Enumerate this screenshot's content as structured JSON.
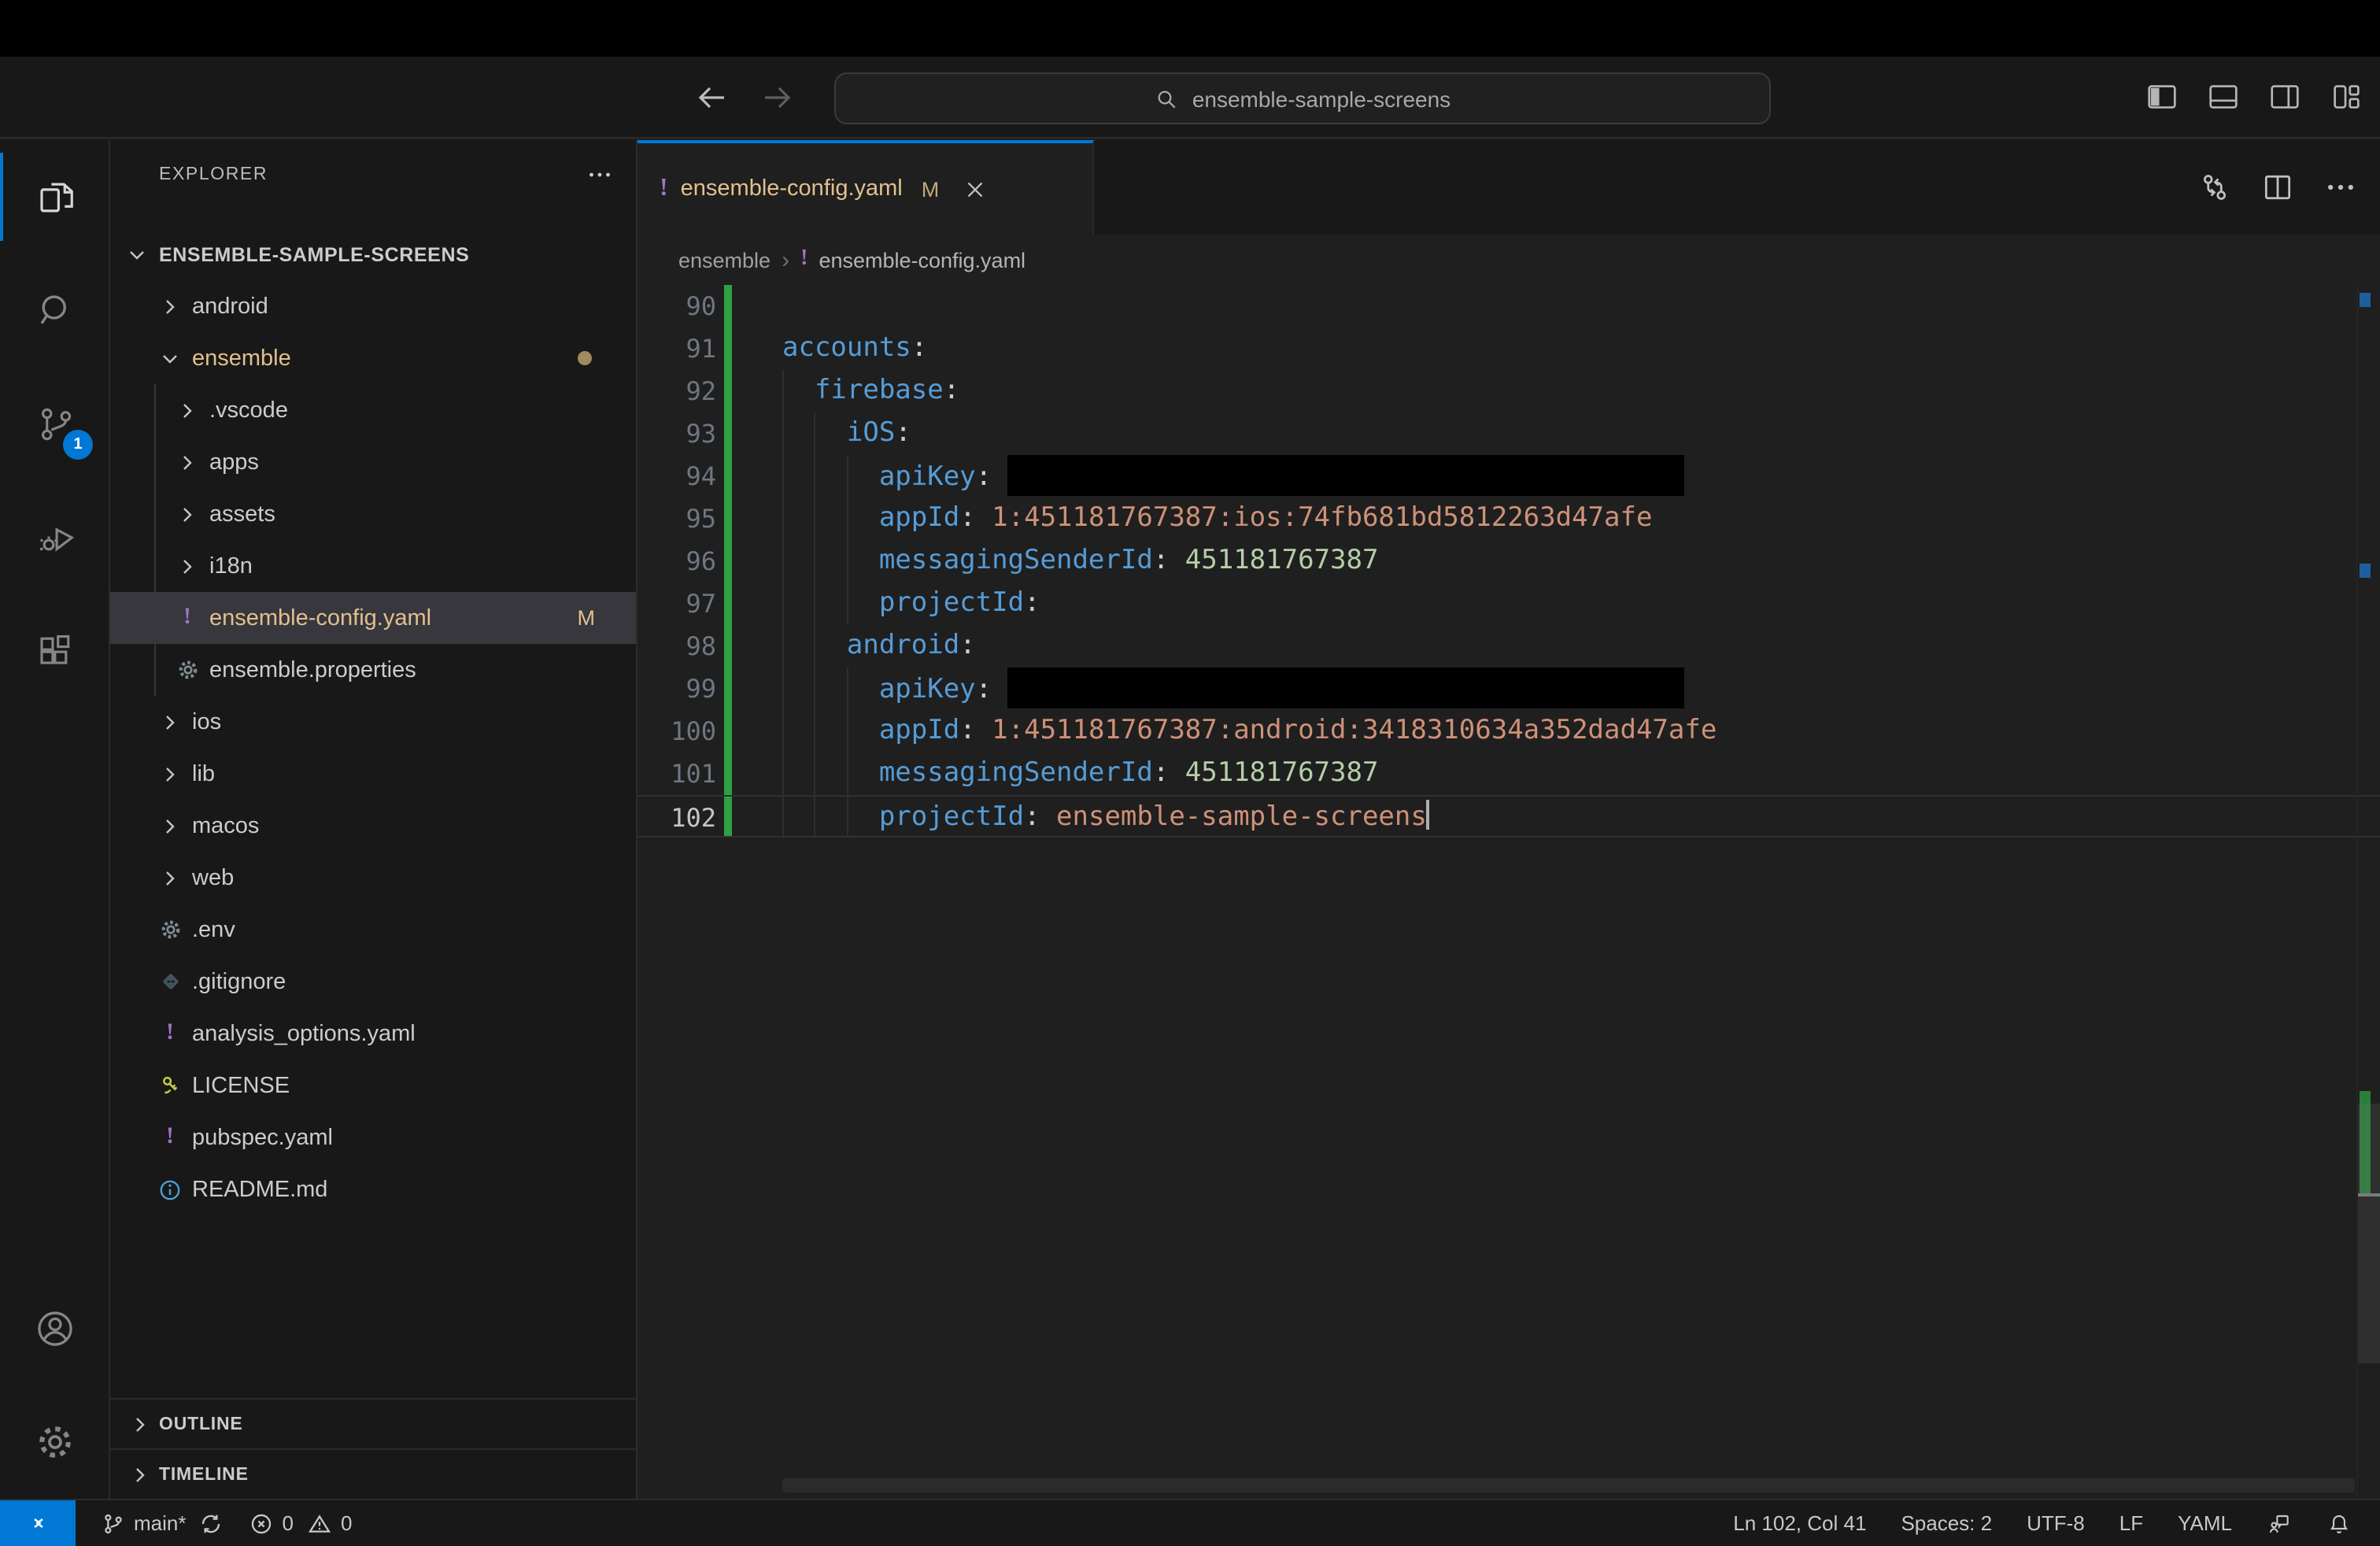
{
  "titlebar": {
    "search_label": "ensemble-sample-screens"
  },
  "activity_bar": {
    "scm_badge": "1"
  },
  "explorer": {
    "header": "EXPLORER",
    "root_label": "ENSEMBLE-SAMPLE-SCREENS",
    "items": [
      {
        "label": "android"
      },
      {
        "label": "ensemble"
      },
      {
        "label": ".vscode"
      },
      {
        "label": "apps"
      },
      {
        "label": "assets"
      },
      {
        "label": "i18n"
      },
      {
        "label": "ensemble-config.yaml",
        "badge": "M"
      },
      {
        "label": "ensemble.properties"
      },
      {
        "label": "ios"
      },
      {
        "label": "lib"
      },
      {
        "label": "macos"
      },
      {
        "label": "web"
      },
      {
        "label": ".env"
      },
      {
        "label": ".gitignore"
      },
      {
        "label": "analysis_options.yaml"
      },
      {
        "label": "LICENSE"
      },
      {
        "label": "pubspec.yaml"
      },
      {
        "label": "README.md"
      }
    ],
    "outline_label": "OUTLINE",
    "timeline_label": "TIMELINE"
  },
  "tab": {
    "label": "ensemble-config.yaml",
    "badge": "M"
  },
  "breadcrumb": {
    "folder": "ensemble",
    "file": "ensemble-config.yaml"
  },
  "icons": {
    "yaml_bang": "!",
    "breadcrumb_sep": "›"
  },
  "editor": {
    "language": "yaml",
    "lines": [
      {
        "num": "90",
        "key": "",
        "colon": "",
        "value": ""
      },
      {
        "num": "91",
        "key": "accounts",
        "colon": ":",
        "value": ""
      },
      {
        "num": "92",
        "key": "firebase",
        "colon": ":",
        "value": ""
      },
      {
        "num": "93",
        "key": "iOS",
        "colon": ":",
        "value": ""
      },
      {
        "num": "94",
        "key": "apiKey",
        "colon": ": ",
        "value": "",
        "redacted": true
      },
      {
        "num": "95",
        "key": "appId",
        "colon": ": ",
        "value": "1:451181767387:ios:74fb681bd5812263d47afe"
      },
      {
        "num": "96",
        "key": "messagingSenderId",
        "colon": ": ",
        "value": "451181767387"
      },
      {
        "num": "97",
        "key": "projectId",
        "colon": ":",
        "value": ""
      },
      {
        "num": "98",
        "key": "android",
        "colon": ":",
        "value": ""
      },
      {
        "num": "99",
        "key": "apiKey",
        "colon": ": ",
        "value": "",
        "redacted": true
      },
      {
        "num": "100",
        "key": "appId",
        "colon": ": ",
        "value": "1:451181767387:android:3418310634a352dad47afe"
      },
      {
        "num": "101",
        "key": "messagingSenderId",
        "colon": ": ",
        "value": "451181767387"
      },
      {
        "num": "102",
        "key": "projectId",
        "colon": ": ",
        "value": "ensemble-sample-screens"
      }
    ]
  },
  "status_bar": {
    "branch": "main*",
    "errors": "0",
    "warnings": "0",
    "line_col": "Ln 102, Col 41",
    "spaces": "Spaces: 2",
    "encoding": "UTF-8",
    "eol": "LF",
    "language": "YAML"
  },
  "colors": {
    "accent": "#0078d4",
    "git_modified": "#e2c08d",
    "git_added_gutter": "#2ea043",
    "yaml_icon": "#a074c4",
    "syntax_key": "#569cd6",
    "syntax_string": "#ce9178",
    "syntax_number": "#b5cea8"
  }
}
